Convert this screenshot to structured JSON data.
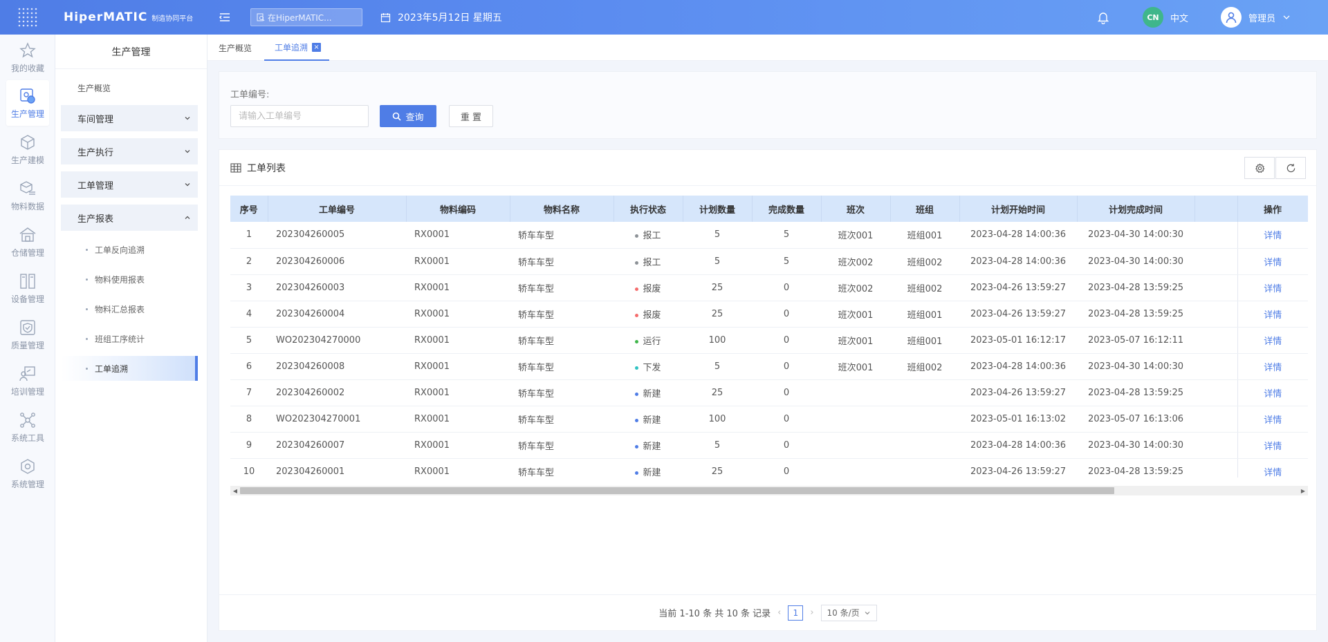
{
  "header": {
    "brand": "HiperMATIC",
    "brand_sub": "制造协同平台",
    "search_placeholder": "在HiperMATIC...",
    "date": "2023年5月12日 星期五",
    "lang_badge": "CN",
    "lang_label": "中文",
    "user_name": "管理员"
  },
  "rail": {
    "items": [
      {
        "label": "我的收藏",
        "icon": "star-icon"
      },
      {
        "label": "生产管理",
        "icon": "production-icon"
      },
      {
        "label": "生产建模",
        "icon": "cube-icon"
      },
      {
        "label": "物料数据",
        "icon": "material-icon"
      },
      {
        "label": "仓储管理",
        "icon": "warehouse-icon"
      },
      {
        "label": "设备管理",
        "icon": "equipment-icon"
      },
      {
        "label": "质量管理",
        "icon": "shield-icon"
      },
      {
        "label": "培训管理",
        "icon": "training-icon"
      },
      {
        "label": "系统工具",
        "icon": "network-icon"
      },
      {
        "label": "系统管理",
        "icon": "settings-cube-icon"
      }
    ]
  },
  "submenu": {
    "title": "生产管理",
    "overview": "生产概览",
    "groups": [
      "车间管理",
      "生产执行",
      "工单管理",
      "生产报表"
    ],
    "children": [
      "工单反向追溯",
      "物料使用报表",
      "物料汇总报表",
      "班组工序统计",
      "工单追溯"
    ]
  },
  "tabs": {
    "overview": "生产概览",
    "trace": "工单追溯",
    "close": "×"
  },
  "filter": {
    "label": "工单编号:",
    "placeholder": "请输入工单编号",
    "query": "查询",
    "reset": "重 置"
  },
  "table": {
    "title": "工单列表",
    "columns": [
      "序号",
      "工单编号",
      "物料编码",
      "物料名称",
      "执行状态",
      "计划数量",
      "完成数量",
      "班次",
      "班组",
      "计划开始时间",
      "计划完成时间",
      "",
      "操作"
    ],
    "rows": [
      {
        "idx": "1",
        "no": "202304260005",
        "code": "RX0001",
        "name": "轿车车型",
        "status": "报工",
        "plan": "5",
        "done": "5",
        "shift": "班次001",
        "team": "班组001",
        "start": "2023-04-28 14:00:36",
        "end": "2023-04-30 14:00:30",
        "op": "详情"
      },
      {
        "idx": "2",
        "no": "202304260006",
        "code": "RX0001",
        "name": "轿车车型",
        "status": "报工",
        "plan": "5",
        "done": "5",
        "shift": "班次002",
        "team": "班组002",
        "start": "2023-04-28 14:00:36",
        "end": "2023-04-30 14:00:30",
        "op": "详情"
      },
      {
        "idx": "3",
        "no": "202304260003",
        "code": "RX0001",
        "name": "轿车车型",
        "status": "报废",
        "plan": "25",
        "done": "0",
        "shift": "班次002",
        "team": "班组002",
        "start": "2023-04-26 13:59:27",
        "end": "2023-04-28 13:59:25",
        "op": "详情"
      },
      {
        "idx": "4",
        "no": "202304260004",
        "code": "RX0001",
        "name": "轿车车型",
        "status": "报废",
        "plan": "25",
        "done": "0",
        "shift": "班次001",
        "team": "班组001",
        "start": "2023-04-26 13:59:27",
        "end": "2023-04-28 13:59:25",
        "op": "详情"
      },
      {
        "idx": "5",
        "no": "WO202304270000",
        "code": "RX0001",
        "name": "轿车车型",
        "status": "运行",
        "plan": "100",
        "done": "0",
        "shift": "班次001",
        "team": "班组001",
        "start": "2023-05-01 16:12:17",
        "end": "2023-05-07 16:12:11",
        "op": "详情"
      },
      {
        "idx": "6",
        "no": "202304260008",
        "code": "RX0001",
        "name": "轿车车型",
        "status": "下发",
        "plan": "5",
        "done": "0",
        "shift": "班次001",
        "team": "班组002",
        "start": "2023-04-28 14:00:36",
        "end": "2023-04-30 14:00:30",
        "op": "详情"
      },
      {
        "idx": "7",
        "no": "202304260002",
        "code": "RX0001",
        "name": "轿车车型",
        "status": "新建",
        "plan": "25",
        "done": "0",
        "shift": "",
        "team": "",
        "start": "2023-04-26 13:59:27",
        "end": "2023-04-28 13:59:25",
        "op": "详情"
      },
      {
        "idx": "8",
        "no": "WO202304270001",
        "code": "RX0001",
        "name": "轿车车型",
        "status": "新建",
        "plan": "100",
        "done": "0",
        "shift": "",
        "team": "",
        "start": "2023-05-01 16:13:02",
        "end": "2023-05-07 16:13:06",
        "op": "详情"
      },
      {
        "idx": "9",
        "no": "202304260007",
        "code": "RX0001",
        "name": "轿车车型",
        "status": "新建",
        "plan": "5",
        "done": "0",
        "shift": "",
        "team": "",
        "start": "2023-04-28 14:00:36",
        "end": "2023-04-30 14:00:30",
        "op": "详情"
      },
      {
        "idx": "10",
        "no": "202304260001",
        "code": "RX0001",
        "name": "轿车车型",
        "status": "新建",
        "plan": "25",
        "done": "0",
        "shift": "",
        "team": "",
        "start": "2023-04-26 13:59:27",
        "end": "2023-04-28 13:59:25",
        "op": "详情"
      }
    ],
    "status_colors": {
      "报工": "#8c9196",
      "报废": "#f56c6c",
      "运行": "#3fb64a",
      "下发": "#2fc2c2",
      "新建": "#4f7de6"
    }
  },
  "pagination": {
    "summary": "当前 1-10 条 共 10 条 记录",
    "current": "1",
    "page_size": "10 条/页"
  },
  "colors": {
    "accent": "#4f7de6",
    "header_row": "#d6e6fb"
  }
}
